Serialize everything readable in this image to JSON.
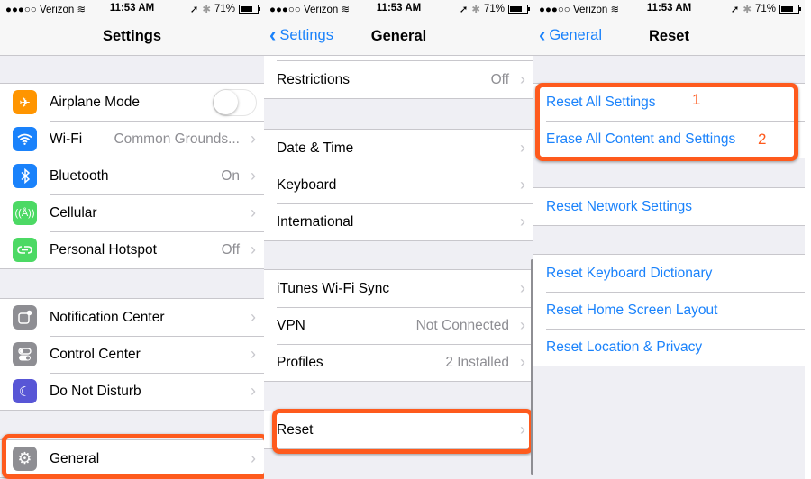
{
  "status_bar": {
    "signal": "●●●○○",
    "carrier": "Verizon",
    "time": "11:53 AM",
    "battery_label": "71%",
    "battery_level": 0.71
  },
  "screen1": {
    "title": "Settings",
    "group1": [
      {
        "label": "Airplane Mode",
        "icon": "airplane-icon",
        "color": "#ff9500",
        "toggle": false
      },
      {
        "label": "Wi-Fi",
        "icon": "wifi-icon",
        "color": "#1a82fb",
        "value": "Common Grounds..."
      },
      {
        "label": "Bluetooth",
        "icon": "bluetooth-icon",
        "color": "#1a82fb",
        "value": "On"
      },
      {
        "label": "Cellular",
        "icon": "cellular-icon",
        "color": "#4cd964",
        "value": ""
      },
      {
        "label": "Personal Hotspot",
        "icon": "hotspot-icon",
        "color": "#4cd964",
        "value": "Off"
      }
    ],
    "group2": [
      {
        "label": "Notification Center",
        "icon": "notification-center-icon",
        "color": "#8e8e93"
      },
      {
        "label": "Control Center",
        "icon": "control-center-icon",
        "color": "#8e8e93"
      },
      {
        "label": "Do Not Disturb",
        "icon": "moon-icon",
        "color": "#5856d6"
      }
    ],
    "group3": [
      {
        "label": "General",
        "icon": "gear-icon",
        "color": "#8e8e93"
      }
    ]
  },
  "screen2": {
    "back_label": "Settings",
    "title": "General",
    "group1": [
      {
        "label": "Restrictions",
        "value": "Off"
      }
    ],
    "group2": [
      {
        "label": "Date & Time",
        "value": ""
      },
      {
        "label": "Keyboard",
        "value": ""
      },
      {
        "label": "International",
        "value": ""
      }
    ],
    "group3": [
      {
        "label": "iTunes Wi-Fi Sync",
        "value": ""
      },
      {
        "label": "VPN",
        "value": "Not Connected"
      },
      {
        "label": "Profiles",
        "value": "2 Installed"
      }
    ],
    "group4": [
      {
        "label": "Reset",
        "value": ""
      }
    ]
  },
  "screen3": {
    "back_label": "General",
    "title": "Reset",
    "group1": [
      {
        "label": "Reset All Settings",
        "annotation": "1"
      },
      {
        "label": "Erase All Content and Settings",
        "annotation": "2"
      }
    ],
    "group2": [
      {
        "label": "Reset Network Settings"
      }
    ],
    "group3": [
      {
        "label": "Reset Keyboard Dictionary"
      },
      {
        "label": "Reset Home Screen Layout"
      },
      {
        "label": "Reset Location & Privacy"
      }
    ]
  },
  "colors": {
    "accent": "#1a82fb",
    "highlight": "#fe5a1d"
  }
}
